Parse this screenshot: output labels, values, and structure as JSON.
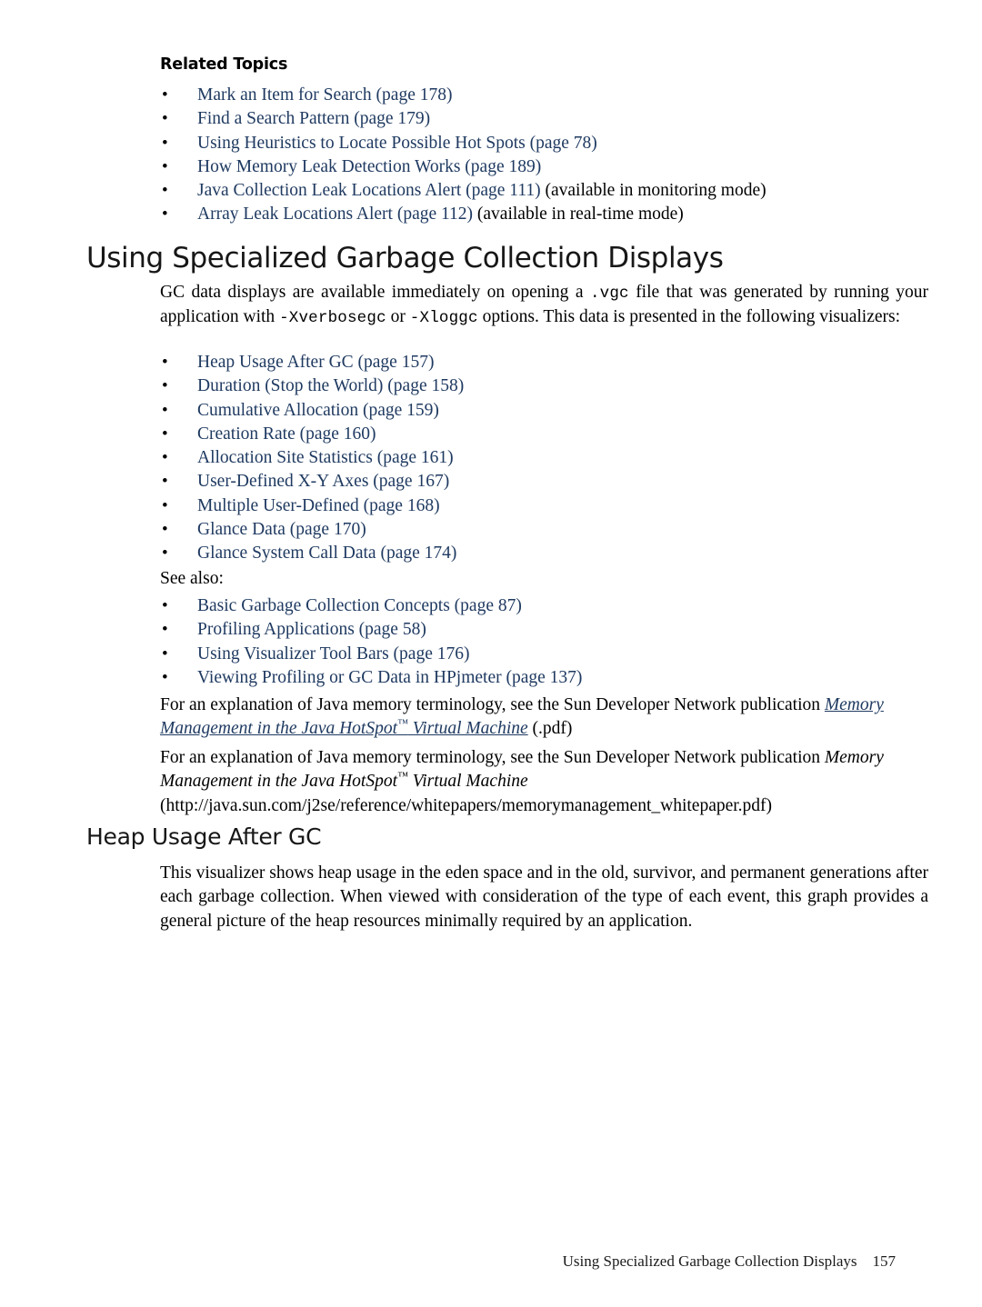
{
  "related": {
    "heading": "Related Topics",
    "items": [
      {
        "link": "Mark an Item for Search (page 178)",
        "suffix": ""
      },
      {
        "link": "Find a Search Pattern (page 179)",
        "suffix": ""
      },
      {
        "link": "Using Heuristics to Locate Possible Hot Spots (page 78)",
        "suffix": ""
      },
      {
        "link": "How Memory Leak Detection Works (page 189)",
        "suffix": ""
      },
      {
        "link": "Java Collection Leak Locations Alert (page 111)",
        "suffix": " (available in monitoring mode)"
      },
      {
        "link": "Array Leak Locations Alert (page 112)",
        "suffix": " (available in real-time mode)"
      }
    ]
  },
  "section": {
    "title": "Using Specialized Garbage Collection Displays",
    "intro_1": "GC data displays are available immediately on opening a ",
    "intro_code_1": ".vgc",
    "intro_2": " file that was generated by running your application with ",
    "intro_code_2": "-Xverbosegc",
    "intro_3": " or ",
    "intro_code_3": "-Xloggc",
    "intro_4": " options. This data is presented in the following visualizers:",
    "visualizers": [
      "Heap Usage After GC (page 157)",
      "Duration (Stop the World) (page 158)",
      "Cumulative Allocation (page 159)",
      "Creation Rate (page 160)",
      "Allocation Site Statistics (page 161)",
      "User-Defined X-Y Axes (page 167)",
      "Multiple User-Defined (page 168)",
      "Glance Data (page 170)",
      "Glance System Call Data (page 174)"
    ],
    "see_also_label": "See also:",
    "see_also": [
      "Basic Garbage Collection Concepts (page 87)",
      "Profiling Applications  (page 58)",
      "Using Visualizer Tool Bars (page 176)",
      "Viewing Profiling or GC Data in HPjmeter (page 137)"
    ],
    "ref_para_1_lead": "For an explanation of Java memory terminology, see the Sun Developer Network publication ",
    "ref_para_1_title": "Memory Management in the Java HotSpot",
    "ref_para_1_title_tail": " Virtual Machine",
    "ref_para_1_tail": " (.pdf)",
    "ref_para_2_lead": "For an explanation of Java memory terminology, see the Sun Developer Network publication ",
    "ref_para_2_title": "Memory Management in the Java HotSpot",
    "ref_para_2_title_tail": " Virtual Machine",
    "ref_para_2_url": "(http://java.sun.com/j2se/reference/whitepapers/memorymanagement_whitepaper.pdf)",
    "trademark": "™"
  },
  "heap": {
    "title": "Heap Usage After GC",
    "body": "This visualizer shows heap usage in the eden space and in the old, survivor, and permanent generations after each garbage collection. When viewed with consideration of the type of each event, this graph provides a general picture of the heap resources minimally required by an application."
  },
  "footer": {
    "title": "Using Specialized Garbage Collection Displays",
    "page_number": "157"
  },
  "colors": {
    "link": "#1f3a61",
    "text": "#000000",
    "heading": "#171717"
  }
}
